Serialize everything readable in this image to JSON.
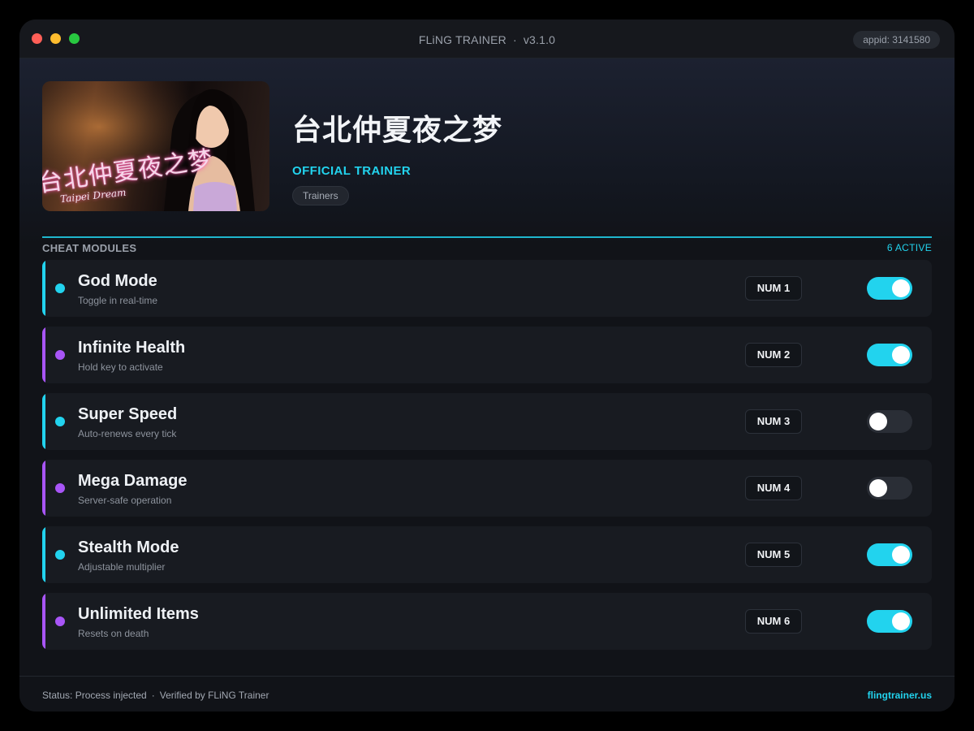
{
  "window": {
    "app_name": "FLiNG TRAINER",
    "separator": "·",
    "version": "v3.1.0",
    "appid": "appid: 3141580"
  },
  "game": {
    "title": "台北仲夏夜之梦",
    "subtitle": "OFFICIAL TRAINER",
    "tag": "Trainers",
    "cover_title": "台北仲夏夜之梦",
    "cover_subtitle": "Taipei Dream"
  },
  "modules": {
    "label": "CHEAT MODULES",
    "active_count": "6 ACTIVE",
    "items": [
      {
        "name": "God Mode",
        "desc": "Toggle in real-time",
        "key": "NUM 1",
        "accent": "#22d3ee",
        "enabled": true
      },
      {
        "name": "Infinite Health",
        "desc": "Hold key to activate",
        "key": "NUM 2",
        "accent": "#a855f7",
        "enabled": true
      },
      {
        "name": "Super Speed",
        "desc": "Auto-renews every tick",
        "key": "NUM 3",
        "accent": "#22d3ee",
        "enabled": false
      },
      {
        "name": "Mega Damage",
        "desc": "Server-safe operation",
        "key": "NUM 4",
        "accent": "#a855f7",
        "enabled": false
      },
      {
        "name": "Stealth Mode",
        "desc": "Adjustable multiplier",
        "key": "NUM 5",
        "accent": "#22d3ee",
        "enabled": true
      },
      {
        "name": "Unlimited Items",
        "desc": "Resets on death",
        "key": "NUM 6",
        "accent": "#a855f7",
        "enabled": true
      }
    ]
  },
  "footer": {
    "status": "Status: Process injected",
    "separator": "·",
    "verified": "Verified by FLiNG Trainer",
    "site": "flingtrainer.us"
  },
  "colors": {
    "accent_cyan": "#22d3ee",
    "accent_purple": "#a855f7"
  }
}
